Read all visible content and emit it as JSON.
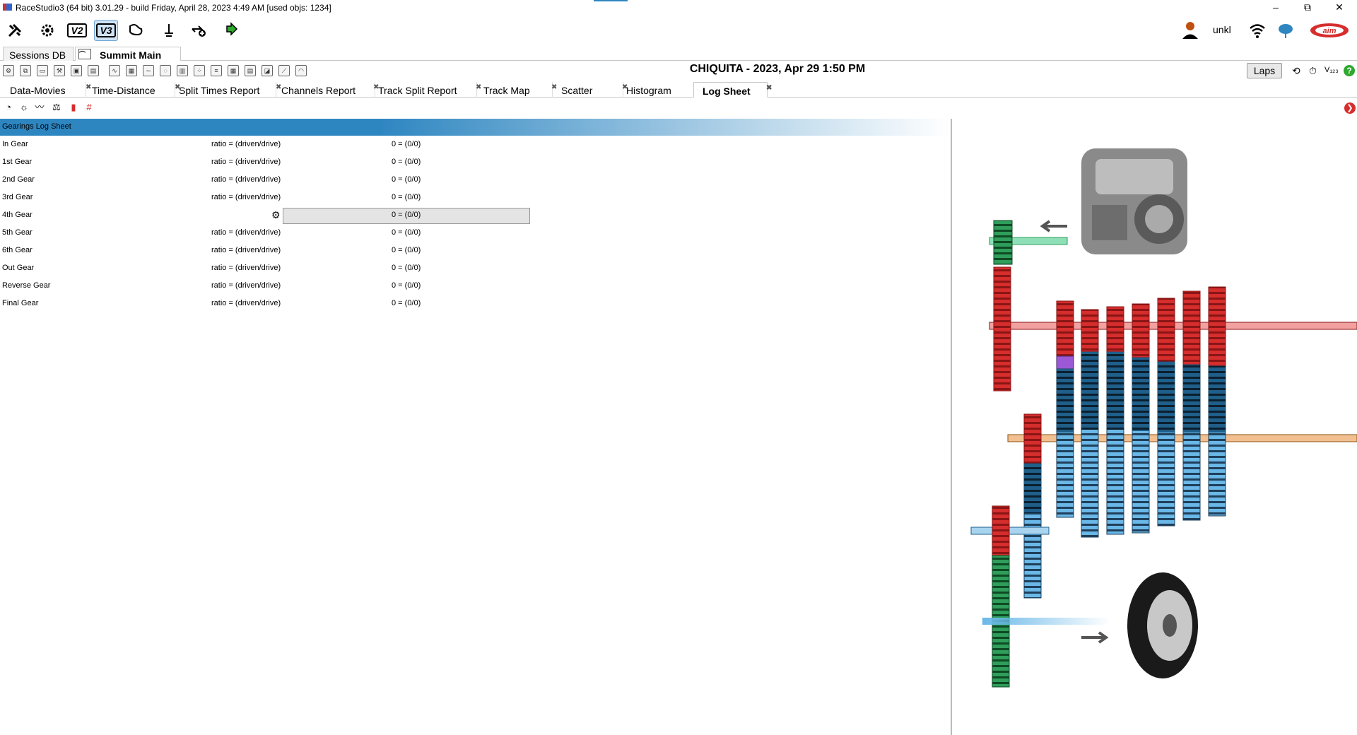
{
  "titlebar": {
    "title": "RaceStudio3 (64 bit) 3.01.29 - build Friday, April 28, 2023 4:49 AM   [used objs: 1234]",
    "minimize": "–",
    "maximize": "⧉",
    "close": "✕"
  },
  "toolbar": {
    "user": "unkl",
    "icons": [
      "tools-icon",
      "gear-settings-icon",
      "v2-icon",
      "v3-icon",
      "track-icon",
      "gauge-icon",
      "globe-add-icon",
      "download-icon"
    ],
    "v2_label": "V2",
    "v3_label": "V3"
  },
  "doc_tabs": [
    {
      "label": "Sessions DB"
    },
    {
      "label": "Summit Main"
    }
  ],
  "session": {
    "title": "CHIQUITA  - 2023, Apr 29 1:50 PM",
    "laps_label": "Laps"
  },
  "report_tabs": [
    {
      "label": "Data-Movies"
    },
    {
      "label": "Time-Distance"
    },
    {
      "label": "Split Times Report"
    },
    {
      "label": "Channels Report"
    },
    {
      "label": "Track Split Report"
    },
    {
      "label": "Track Map"
    },
    {
      "label": "Scatter"
    },
    {
      "label": "Histogram"
    },
    {
      "label": "Log Sheet"
    }
  ],
  "log_sheet": {
    "header": "Gearings Log Sheet",
    "rows": [
      {
        "name": "In Gear",
        "formula": "ratio = (driven/drive)",
        "value": "0 = (0/0)"
      },
      {
        "name": "1st Gear",
        "formula": "ratio = (driven/drive)",
        "value": "0 = (0/0)"
      },
      {
        "name": "2nd Gear",
        "formula": "ratio = (driven/drive)",
        "value": "0 = (0/0)"
      },
      {
        "name": "3rd Gear",
        "formula": "ratio = (driven/drive)",
        "value": "0 = (0/0)"
      },
      {
        "name": "4th Gear",
        "formula": "",
        "value": "0 = (0/0)"
      },
      {
        "name": "5th Gear",
        "formula": "ratio = (driven/drive)",
        "value": "0 = (0/0)"
      },
      {
        "name": "6th Gear",
        "formula": "ratio = (driven/drive)",
        "value": "0 = (0/0)"
      },
      {
        "name": "Out Gear",
        "formula": "ratio = (driven/drive)",
        "value": "0 = (0/0)"
      },
      {
        "name": "Reverse Gear",
        "formula": "ratio = (driven/drive)",
        "value": "0 = (0/0)"
      },
      {
        "name": "Final Gear",
        "formula": "ratio = (driven/drive)",
        "value": "0 = (0/0)"
      }
    ]
  },
  "colors": {
    "header_blue": "#2e86c1",
    "gear_red": "#d62d2d",
    "gear_blue_dark": "#1f5f8a",
    "gear_blue_light": "#6ab8e8",
    "gear_green": "#2e9e5a",
    "shaft_orange": "#e8a050"
  }
}
